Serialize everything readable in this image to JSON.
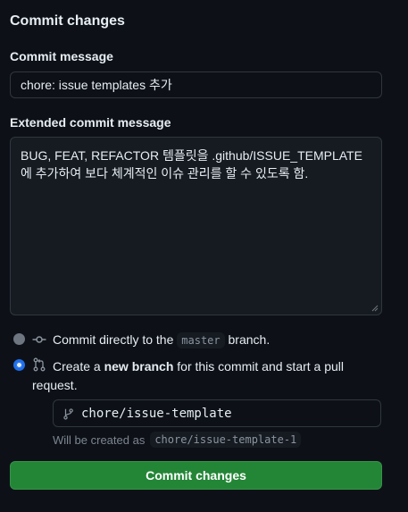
{
  "title": "Commit changes",
  "commit_message": {
    "label": "Commit message",
    "value": "chore: issue templates 추가"
  },
  "extended_message": {
    "label": "Extended commit message",
    "value": "BUG, FEAT, REFACTOR 템플릿을 .github/ISSUE_TEMPLATE에 추가하여 보다 체계적인 이슈 관리를 할 수 있도록 함."
  },
  "options": {
    "direct": {
      "before": "Commit directly to the",
      "branch": "master",
      "after": "branch.",
      "selected": false
    },
    "new_branch": {
      "before": "Create a",
      "bold": "new branch",
      "after_line1": "for this commit and start a pull",
      "after_line2": "request.",
      "selected": true
    }
  },
  "branch_input": {
    "value": "chore/issue-template"
  },
  "hint": {
    "text": "Will be created as",
    "branch": "chore/issue-template-1"
  },
  "submit_label": "Commit changes",
  "icons": {
    "direct": "git-commit-icon",
    "new_branch": "git-pull-request-icon",
    "branch": "git-branch-icon"
  },
  "colors": {
    "background": "#0d1117",
    "primary_button": "#238636",
    "radio_selected": "#1f6feb"
  }
}
